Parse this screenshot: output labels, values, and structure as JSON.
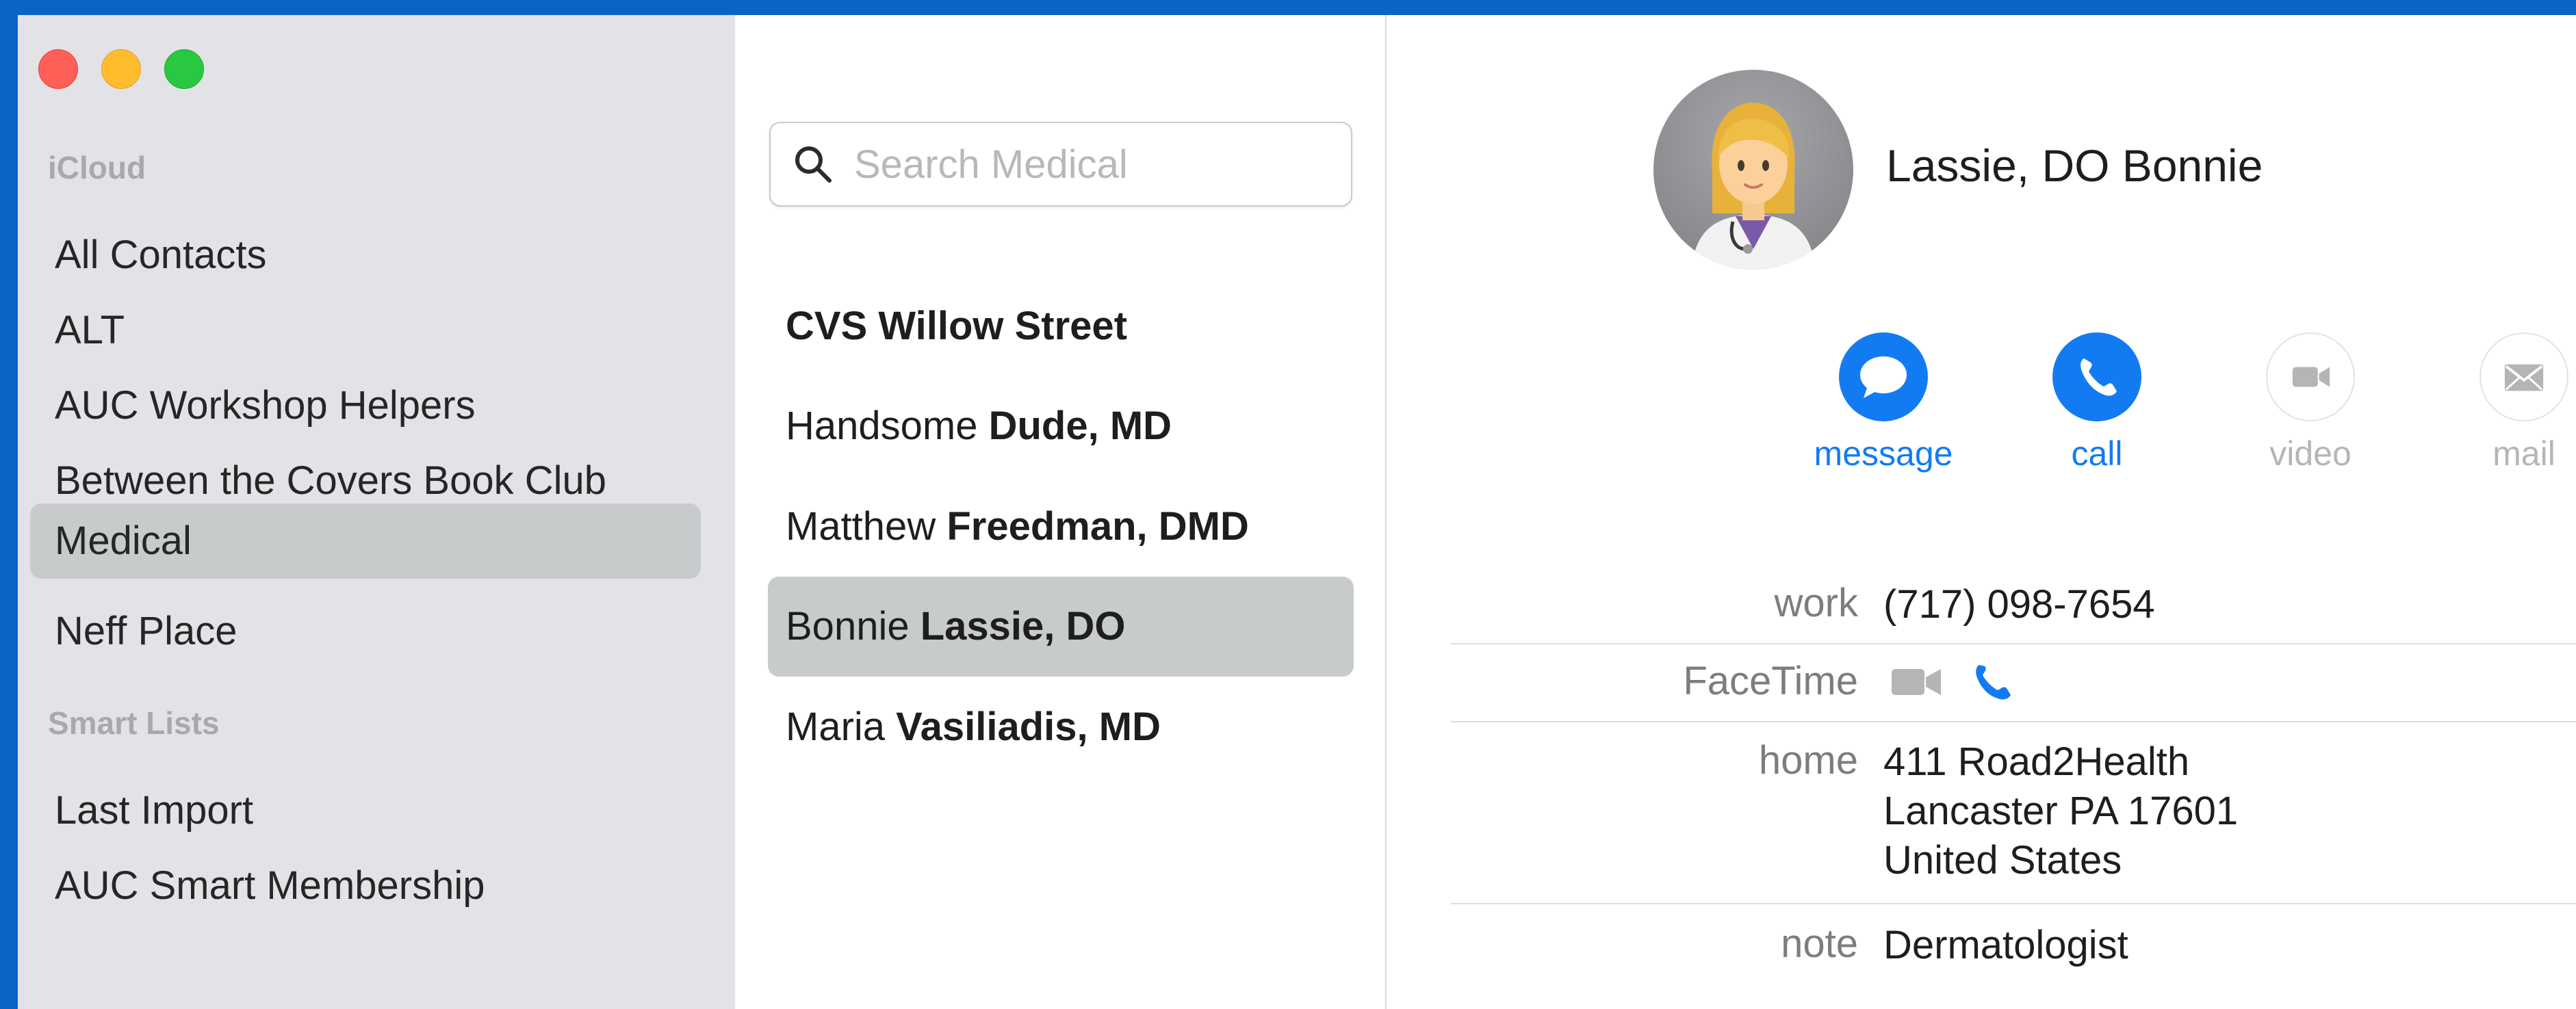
{
  "sidebar": {
    "window_controls": [
      "close",
      "minimize",
      "zoom"
    ],
    "section_icloud": "iCloud",
    "groups": [
      {
        "label": "All Contacts",
        "selected": false
      },
      {
        "label": "ALT",
        "selected": false
      },
      {
        "label": "AUC Workshop Helpers",
        "selected": false
      },
      {
        "label": "Between the Covers Book Club",
        "selected": false
      },
      {
        "label": "Medical",
        "selected": true
      },
      {
        "label": "Neff Place",
        "selected": false
      }
    ],
    "section_smart": "Smart Lists",
    "smart_lists": [
      {
        "label": "Last Import"
      },
      {
        "label": "AUC Smart Membership"
      }
    ]
  },
  "search": {
    "placeholder": "Search Medical",
    "value": ""
  },
  "contacts": [
    {
      "first": "CVS Willow Street",
      "last": "",
      "selected": false
    },
    {
      "first": "Handsome ",
      "last": "Dude, MD",
      "selected": false
    },
    {
      "first": "Matthew ",
      "last": "Freedman, DMD",
      "selected": false
    },
    {
      "first": "Bonnie ",
      "last": "Lassie, DO",
      "selected": true
    },
    {
      "first": "Maria ",
      "last": "Vasiliadis, MD",
      "selected": false
    }
  ],
  "detail": {
    "name": "Lassie, DO Bonnie",
    "avatar_icon": "woman-health-worker-emoji",
    "actions": [
      {
        "label": "message",
        "icon": "message-bubble-icon",
        "enabled": true
      },
      {
        "label": "call",
        "icon": "phone-icon",
        "enabled": true
      },
      {
        "label": "video",
        "icon": "video-camera-icon",
        "enabled": false
      },
      {
        "label": "mail",
        "icon": "envelope-icon",
        "enabled": false
      }
    ],
    "fields": {
      "work_label": "work",
      "work_value": "(717) 098-7654",
      "facetime_label": "FaceTime",
      "home_label": "home",
      "home_line1": "411 Road2Health",
      "home_line2": "Lancaster PA 17601",
      "home_line3": "United States",
      "note_label": "note",
      "note_value": "Dermatologist"
    }
  },
  "colors": {
    "accent": "#137bf2",
    "desktop": "#0a64c6",
    "sidebar_bg": "#e3e2e6",
    "selection": "#c8cbcb"
  }
}
